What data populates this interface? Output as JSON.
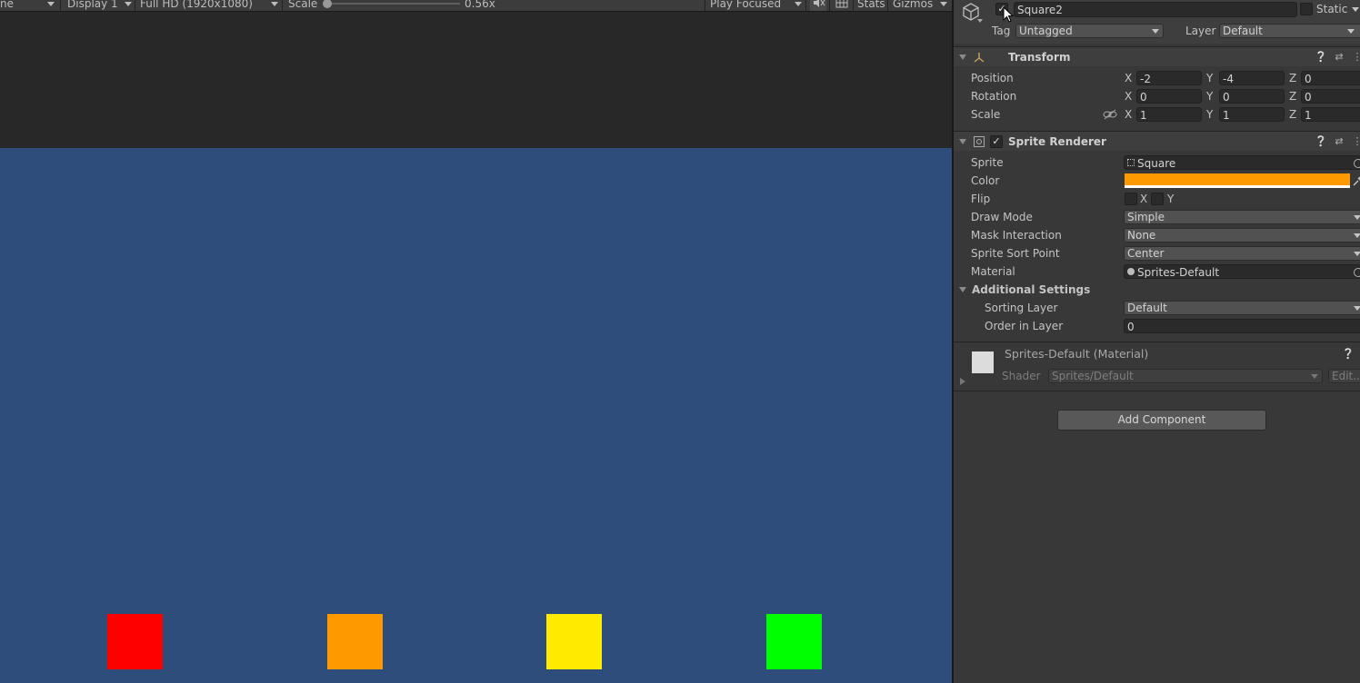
{
  "game_toolbar": {
    "view_mode": "ne",
    "display": "Display 1",
    "resolution": "Full HD (1920x1080)",
    "scale_label": "Scale",
    "scale_value": "0.56x",
    "play_mode": "Play Focused",
    "stats": "Stats",
    "gizmos": "Gizmos"
  },
  "game_view": {
    "background_color": "#2f4d7a",
    "squares": [
      {
        "name": "red",
        "color": "#ff0000"
      },
      {
        "name": "orange",
        "color": "#ff9900"
      },
      {
        "name": "yellow",
        "color": "#ffea00"
      },
      {
        "name": "green",
        "color": "#00ff00"
      }
    ]
  },
  "inspector": {
    "object": {
      "name": "Square2",
      "active": true,
      "static_label": "Static",
      "tag_label": "Tag",
      "tag_value": "Untagged",
      "layer_label": "Layer",
      "layer_value": "Default"
    },
    "transform": {
      "title": "Transform",
      "rows": [
        {
          "label": "Position",
          "x": "-2",
          "y": "-4",
          "z": "0"
        },
        {
          "label": "Rotation",
          "x": "0",
          "y": "0",
          "z": "0"
        },
        {
          "label": "Scale",
          "x": "1",
          "y": "1",
          "z": "1"
        }
      ],
      "axes": [
        "X",
        "Y",
        "Z"
      ]
    },
    "sprite_renderer": {
      "title": "Sprite Renderer",
      "enabled": true,
      "sprite_label": "Sprite",
      "sprite_value": "Square",
      "color_label": "Color",
      "color_value": "#ff9900",
      "flip_label": "Flip",
      "flip_x": "X",
      "flip_y": "Y",
      "draw_mode_label": "Draw Mode",
      "draw_mode_value": "Simple",
      "mask_label": "Mask Interaction",
      "mask_value": "None",
      "sort_point_label": "Sprite Sort Point",
      "sort_point_value": "Center",
      "material_label": "Material",
      "material_value": "Sprites-Default",
      "additional_title": "Additional Settings",
      "sorting_layer_label": "Sorting Layer",
      "sorting_layer_value": "Default",
      "order_label": "Order in Layer",
      "order_value": "0"
    },
    "material": {
      "title": "Sprites-Default (Material)",
      "shader_label": "Shader",
      "shader_value": "Sprites/Default",
      "edit_label": "Edit..."
    },
    "add_component": "Add Component"
  }
}
